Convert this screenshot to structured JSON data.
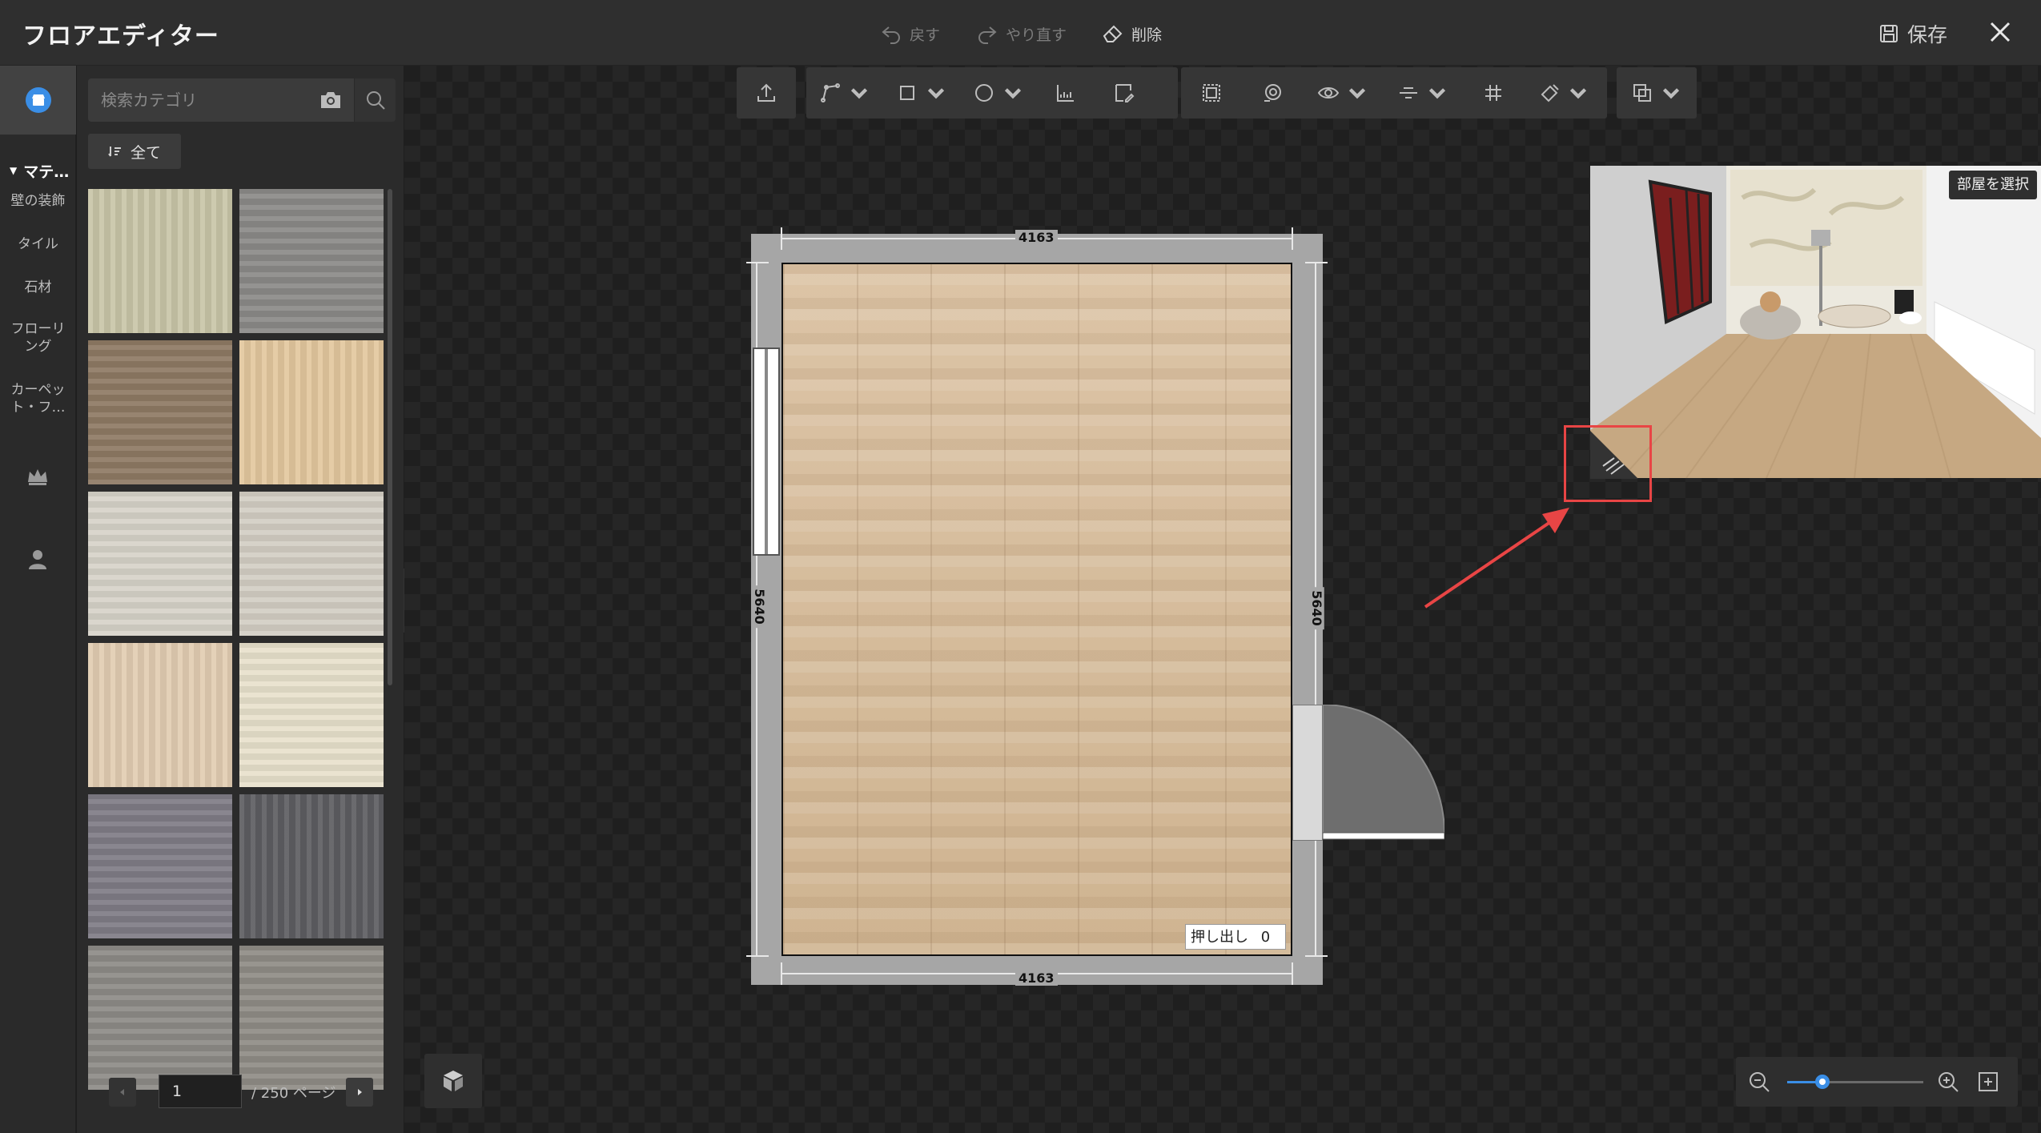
{
  "app": {
    "title": "フロアエディター"
  },
  "titlebar": {
    "undo_label": "戻す",
    "redo_label": "やり直す",
    "delete_label": "削除",
    "save_label": "保存"
  },
  "rail": {
    "section_label": "マテ…",
    "items": [
      {
        "label": "壁の装飾"
      },
      {
        "label": "タイル"
      },
      {
        "label": "石材"
      },
      {
        "label": "フローリ\nング"
      },
      {
        "label": "カーペッ\nト・フ…"
      }
    ],
    "icons": [
      "store-icon",
      "crown-icon",
      "user-icon"
    ]
  },
  "panel": {
    "search_placeholder": "検索カテゴリ",
    "filter_all_label": "全て",
    "tiles": [
      {
        "name": "birch-bark",
        "color": "#c9c6a8"
      },
      {
        "name": "grey-carpet",
        "color": "#8b8a88"
      },
      {
        "name": "dark-oak-planks",
        "color": "#8e7a64"
      },
      {
        "name": "light-maple",
        "color": "#e3c89e"
      },
      {
        "name": "white-marble",
        "color": "#d7d3c9"
      },
      {
        "name": "pale-ash",
        "color": "#d3cec4"
      },
      {
        "name": "beige-marble",
        "color": "#e2cdb2"
      },
      {
        "name": "cream-grid-tile",
        "color": "#e8e1cc"
      },
      {
        "name": "grey-slate",
        "color": "#7f7c86"
      },
      {
        "name": "dark-checker-stone",
        "color": "#5e5e62"
      },
      {
        "name": "grey-wood",
        "color": "#8d8b87"
      },
      {
        "name": "ash-wood",
        "color": "#8f8c86"
      }
    ],
    "pager": {
      "current_page": "1",
      "total_label": "/ 250 ページ"
    }
  },
  "floorplan": {
    "top_dimension": "4163",
    "bottom_dimension": "4163",
    "left_dimension": "5640",
    "right_dimension": "5640",
    "extrude_label": "押し出し",
    "extrude_value": "0"
  },
  "preview": {
    "room_select_label": "部屋を選択"
  },
  "toolbar_icons": [
    "upload-icon",
    "draw-wall-icon",
    "rectangle-room-icon",
    "circle-room-icon",
    "ruler-icon",
    "edit-room-icon",
    "select-area-icon",
    "camera-view-icon",
    "visibility-icon",
    "align-icon",
    "grid-icon",
    "paint-icon",
    "copy-layer-icon"
  ],
  "zoom": {
    "level": 0.26
  },
  "colors": {
    "accent": "#3a8ee6",
    "highlight": "#e84545"
  }
}
